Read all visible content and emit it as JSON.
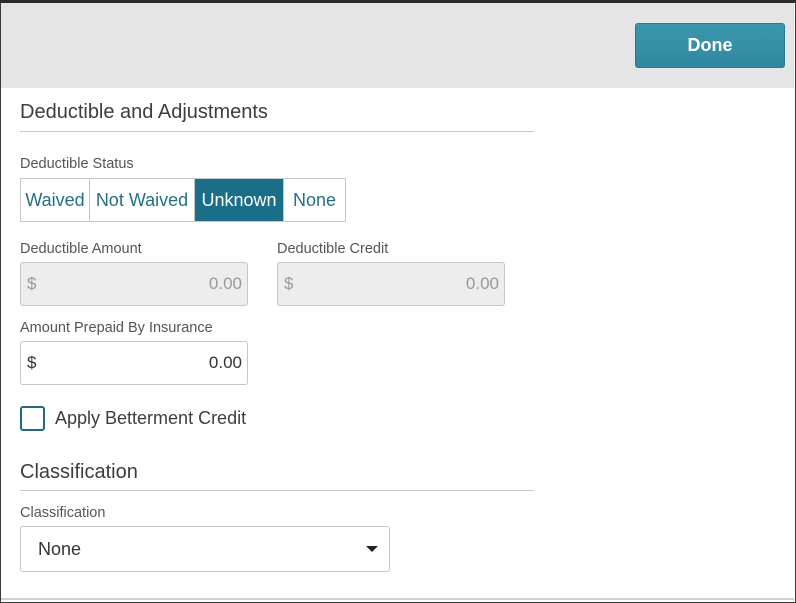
{
  "header": {
    "done_label": "Done"
  },
  "deductible": {
    "section_title": "Deductible and Adjustments",
    "status_label": "Deductible Status",
    "status_options": [
      "Waived",
      "Not Waived",
      "Unknown",
      "None"
    ],
    "selected_status": "Unknown",
    "amount_label": "Deductible Amount",
    "amount_currency": "$",
    "amount_value": "0.00",
    "credit_label": "Deductible Credit",
    "credit_currency": "$",
    "credit_value": "0.00",
    "prepaid_label": "Amount Prepaid By Insurance",
    "prepaid_currency": "$",
    "prepaid_value": "0.00",
    "betterment_label": "Apply Betterment Credit",
    "betterment_checked": false
  },
  "classification": {
    "section_title": "Classification",
    "field_label": "Classification",
    "selected_value": "None"
  },
  "colors": {
    "accent": "#1a6e88",
    "button": "#3390a8",
    "topbar": "#e5e5e5"
  }
}
